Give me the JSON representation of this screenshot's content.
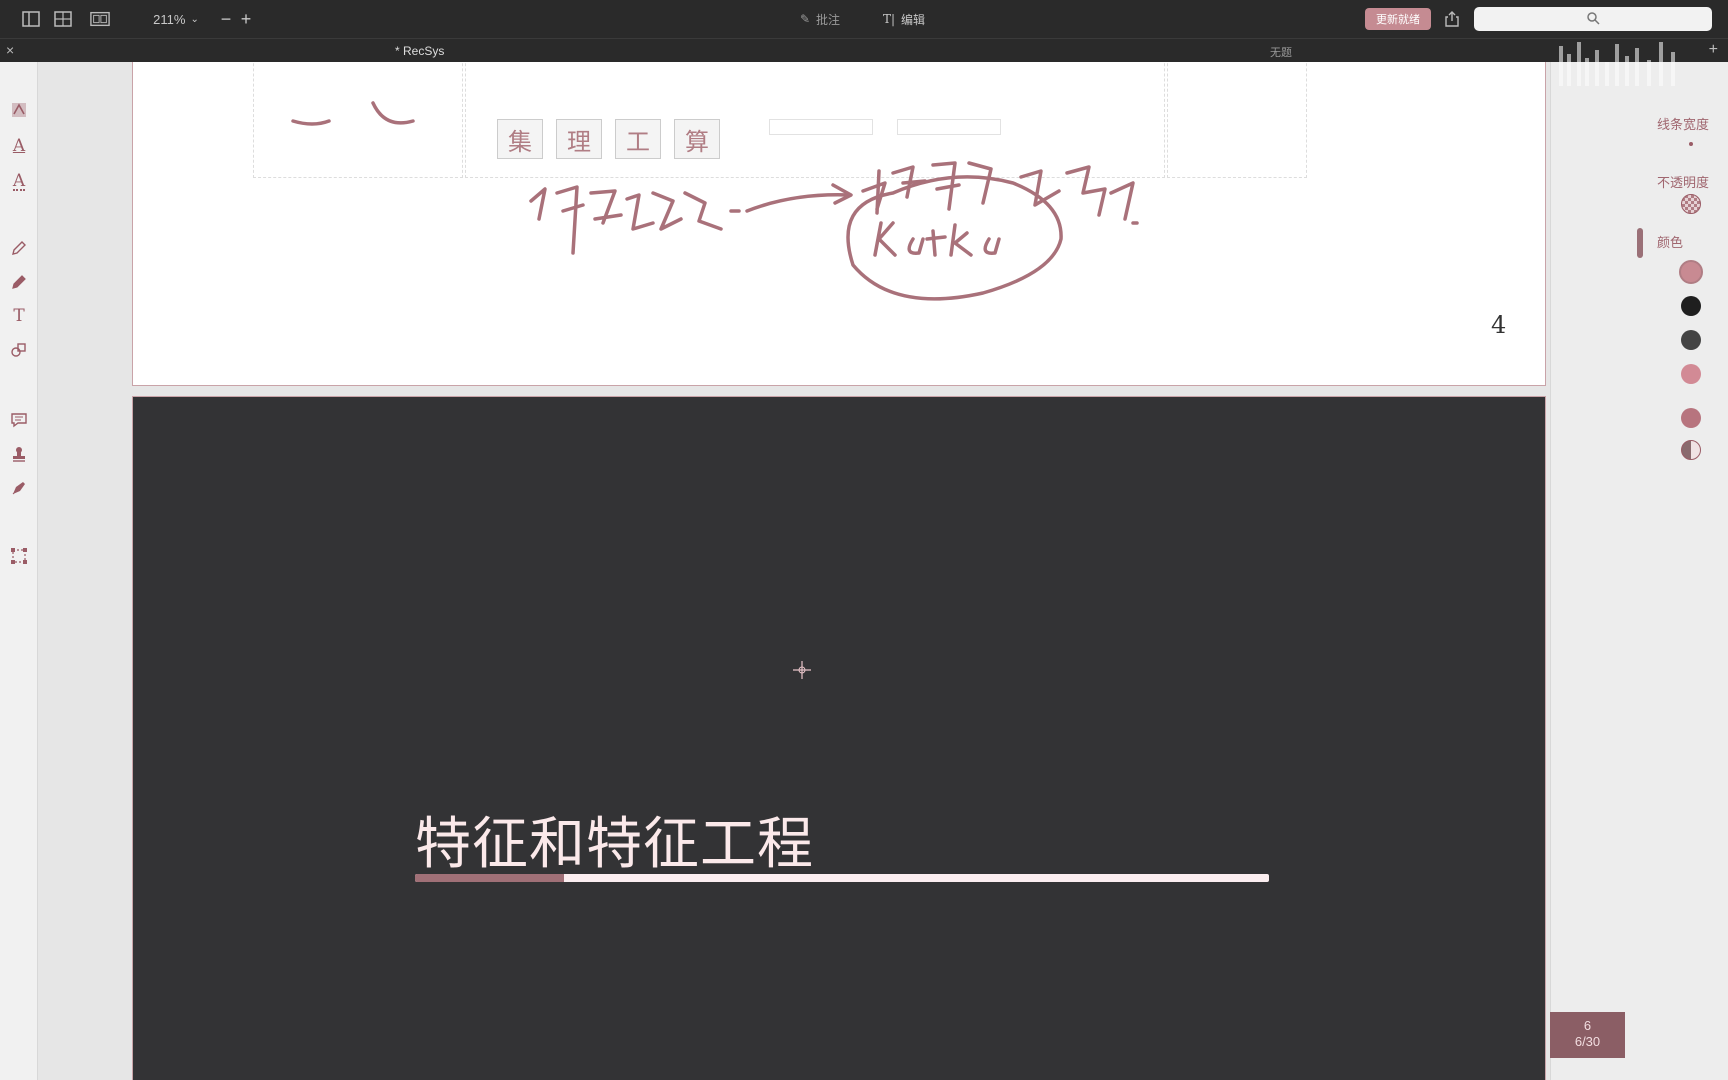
{
  "toolbar": {
    "zoom": "211%",
    "zoom_out": "−",
    "zoom_in": "+",
    "annotate_label": "批注",
    "edit_label": "编辑",
    "update_label": "更新就绪",
    "icons": [
      "sidebar-icon",
      "grid-view-icon",
      "two-page-icon",
      "share-icon",
      "search-icon"
    ]
  },
  "tabs": {
    "close": "×",
    "active_title": "* RecSys",
    "second_title": "无题",
    "add": "+"
  },
  "document": {
    "page4": {
      "page_number": "4",
      "char_boxes": [
        "集",
        "理",
        "工",
        "算"
      ]
    },
    "page5": {
      "title": "特征和特征工程",
      "progress": 0.175
    }
  },
  "right_panel": {
    "line_width_label": "线条宽度",
    "opacity_label": "不透明度",
    "color_label": "颜色",
    "colors": [
      "#c88a92",
      "#1f1f1f",
      "#444444",
      "#d28a95",
      "#b7747e",
      "#8a6a6e"
    ]
  },
  "page_indicator": {
    "current": "6",
    "position": "6/30"
  },
  "colors": {
    "accent": "#c58b92",
    "ink": "#a9717a",
    "slide_bg": "#333335"
  }
}
